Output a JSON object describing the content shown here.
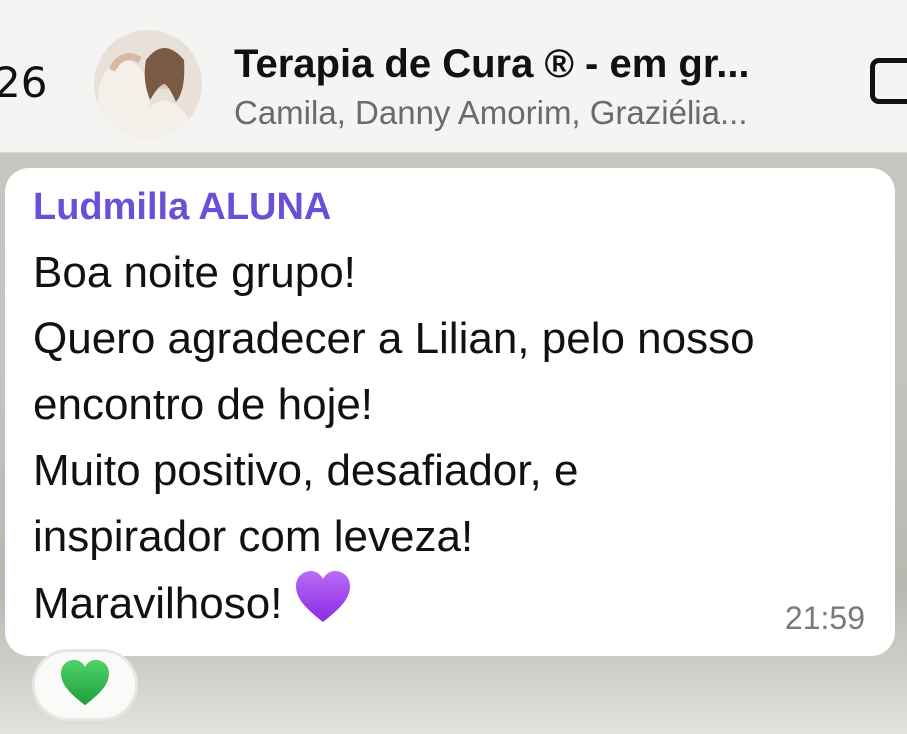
{
  "header": {
    "back_count": "26",
    "title": "Terapia de Cura ® - em gr...",
    "subtitle": "Camila, Danny Amorim, Graziélia...",
    "avatar_icon": "group-avatar-photo",
    "video_icon": "video-call-icon"
  },
  "message": {
    "sender": "Ludmilla ALUNA",
    "sender_color": "#6b4fd8",
    "lines": [
      "Boa noite grupo!",
      "Quero agradecer a Lilian, pelo nosso",
      "encontro de hoje!",
      "Muito positivo, desafiador, e",
      "inspirador com leveza!",
      "Maravilhoso!"
    ],
    "emoji": "purple-heart",
    "time": "21:59"
  },
  "reaction": {
    "emoji": "green-heart",
    "color": "#27b24a"
  }
}
